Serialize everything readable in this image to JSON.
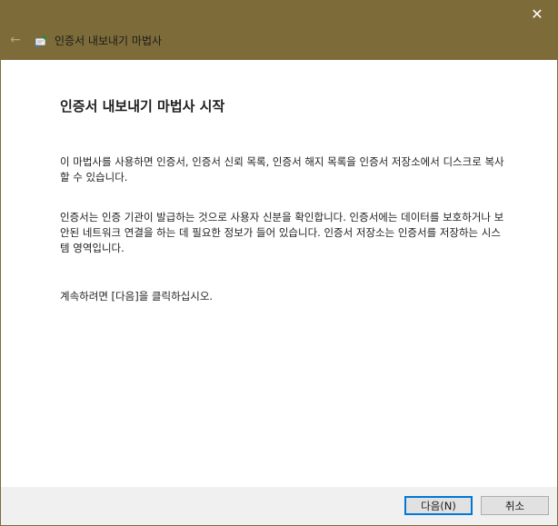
{
  "window": {
    "title": "인증서 내보내기 마법사",
    "close_glyph": "✕",
    "back_glyph": "←"
  },
  "main": {
    "heading": "인증서 내보내기 마법사 시작",
    "paragraphs": [
      "이 마법사를 사용하면 인증서, 인증서 신뢰 목록, 인증서 해지 목록을 인증서 저장소에서 디스크로 복사할 수 있습니다.",
      "인증서는 인증 기관이 발급하는 것으로 사용자 신분을 확인합니다. 인증서에는 데이터를 보호하거나 보안된 네트워크 연결을 하는 데 필요한 정보가 들어 있습니다. 인증서 저장소는 인증서를 저장하는 시스템 영역입니다.",
      "계속하려면 [다음]을 클릭하십시오."
    ]
  },
  "footer": {
    "next_label": "다음(N)",
    "cancel_label": "취소"
  },
  "colors": {
    "titlebar": "#7d6c3a",
    "accent": "#0078d7",
    "footer_bg": "#f0f0f0"
  },
  "icons": {
    "app": "certificate-icon",
    "back": "back-arrow-icon",
    "close": "close-icon"
  }
}
